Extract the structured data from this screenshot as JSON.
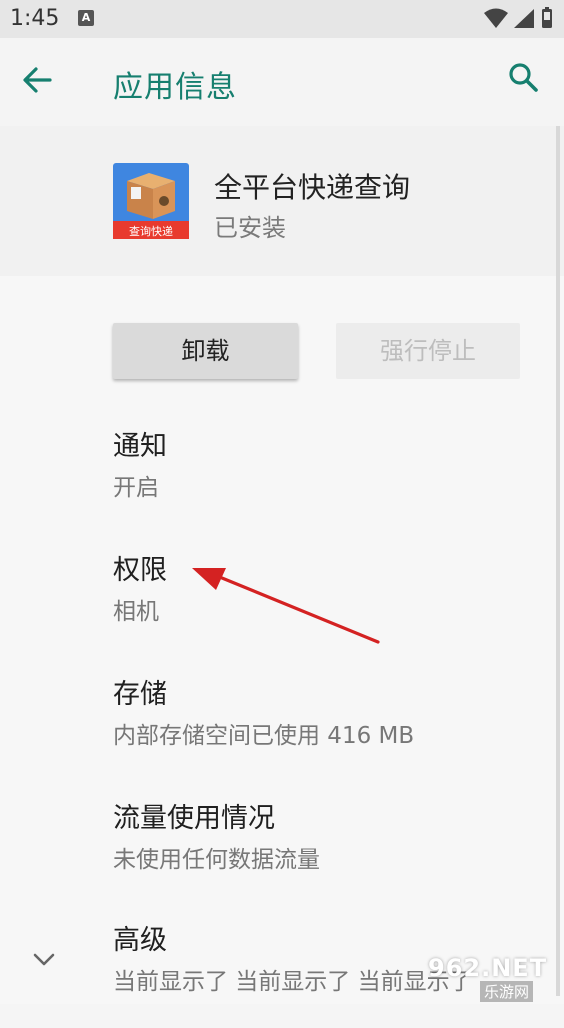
{
  "status_bar": {
    "time": "1:45",
    "notification_letter": "A"
  },
  "app_bar": {
    "title": "应用信息"
  },
  "app": {
    "name": "全平台快递查询",
    "status": "已安装",
    "icon_banner": "查询快递"
  },
  "buttons": {
    "uninstall": "卸载",
    "force_stop": "强行停止"
  },
  "items": [
    {
      "title": "通知",
      "subtitle": "开启"
    },
    {
      "title": "权限",
      "subtitle": "相机"
    },
    {
      "title": "存储",
      "subtitle": "内部存储空间已使用 416 MB"
    },
    {
      "title": "流量使用情况",
      "subtitle": "未使用任何数据流量"
    },
    {
      "title": "高级",
      "subtitle": "当前显示了 当前显示了 当前显示了"
    }
  ],
  "watermark": {
    "top": "962.NET",
    "bottom": "乐游网"
  },
  "colors": {
    "accent": "#167f6f",
    "annotation_arrow": "#d42222"
  }
}
